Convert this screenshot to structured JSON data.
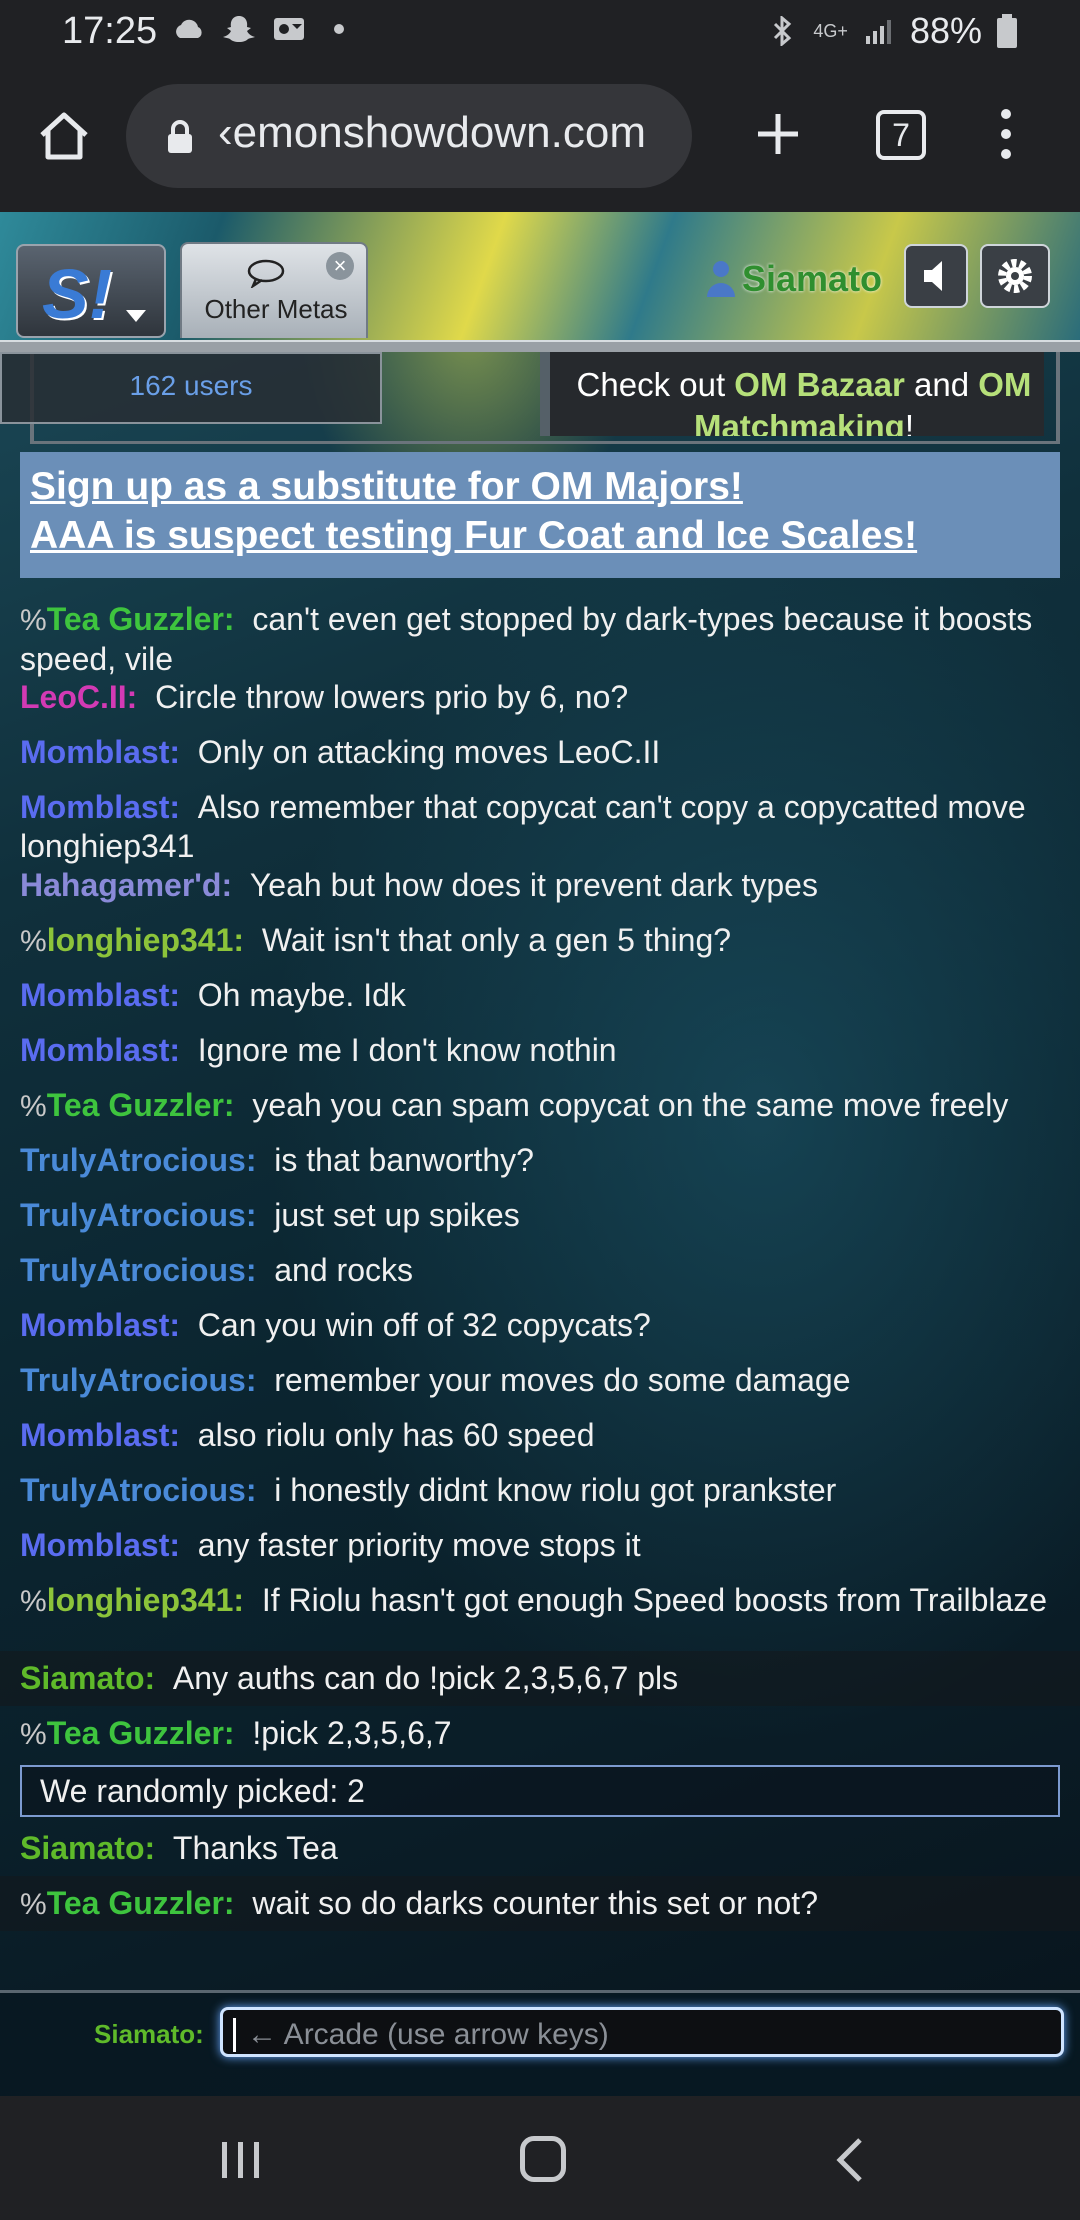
{
  "status_bar": {
    "time": "17:25",
    "network": "4G+",
    "battery": "88%",
    "icons": [
      "cloud-icon",
      "snapchat-icon",
      "outlook-icon",
      "dot-icon",
      "bluetooth-icon",
      "signal-icon",
      "battery-icon"
    ]
  },
  "browser": {
    "url": "‹emonshowdown.com",
    "tab_count": "7"
  },
  "header": {
    "logo_text": "S!",
    "room_tab_label": "Other Metas",
    "room_tab_close": "×",
    "username": "Siamato"
  },
  "room_intro": {
    "users_count": "162 users",
    "om_text_before": "Check out ",
    "om_bazaar": "OM Bazaar",
    "om_and": " and ",
    "om_matchmaking": "OM Matchmaking",
    "om_end": "!"
  },
  "announcement": {
    "line1": "Sign up as a substitute for OM Majors!",
    "line2": "AAA is suspect testing Fur Coat and Ice Scales!"
  },
  "messages": [
    {
      "rank": "%",
      "user": "Tea Guzzler",
      "color": "#3ec43e",
      "text": "can't even get stopped by dark-types because it boosts speed, vile"
    },
    {
      "rank": "",
      "user": "LeoC.II",
      "color": "#d33ab4",
      "text": "Circle throw lowers prio by 6, no?"
    },
    {
      "rank": "",
      "user": "Momblast",
      "color": "#5a6cf0",
      "text": "Only on attacking moves LeoC.II"
    },
    {
      "rank": "",
      "user": "Momblast",
      "color": "#5a6cf0",
      "text": "Also remember that copycat can't copy a copycatted move longhiep341"
    },
    {
      "rank": "",
      "user": "Hahagamer'd",
      "color": "#8a8ad8",
      "text": "Yeah but how does it prevent dark types"
    },
    {
      "rank": "%",
      "user": "longhiep341",
      "color": "#8cc43a",
      "text": "Wait isn't that only a gen 5 thing?"
    },
    {
      "rank": "",
      "user": "Momblast",
      "color": "#5a6cf0",
      "text": "Oh maybe. Idk"
    },
    {
      "rank": "",
      "user": "Momblast",
      "color": "#5a6cf0",
      "text": "Ignore me I don't know nothin"
    },
    {
      "rank": "%",
      "user": "Tea Guzzler",
      "color": "#3ec43e",
      "text": "yeah you can spam copycat on the same move freely"
    },
    {
      "rank": "",
      "user": "TrulyAtrocious",
      "color": "#4a8ad8",
      "text": "is that banworthy?"
    },
    {
      "rank": "",
      "user": "TrulyAtrocious",
      "color": "#4a8ad8",
      "text": "just set up spikes"
    },
    {
      "rank": "",
      "user": "TrulyAtrocious",
      "color": "#4a8ad8",
      "text": "and rocks"
    },
    {
      "rank": "",
      "user": "Momblast",
      "color": "#5a6cf0",
      "text": "Can you win off of 32 copycats?"
    },
    {
      "rank": "",
      "user": "TrulyAtrocious",
      "color": "#4a8ad8",
      "text": "remember your moves do some damage"
    },
    {
      "rank": "",
      "user": "Momblast",
      "color": "#5a6cf0",
      "text": "also riolu only has 60 speed"
    },
    {
      "rank": "",
      "user": "TrulyAtrocious",
      "color": "#4a8ad8",
      "text": "i honestly didnt know riolu got prankster"
    },
    {
      "rank": "",
      "user": "Momblast",
      "color": "#5a6cf0",
      "text": "any faster priority move stops it"
    },
    {
      "rank": "%",
      "user": "longhiep341",
      "color": "#8cc43a",
      "text": "If Riolu hasn't got enough Speed boosts from Trailblaze"
    },
    {
      "rank": "",
      "user": "Siamato",
      "color": "#5fba2a",
      "text": "Any auths can do !pick 2,3,5,6,7 pls"
    },
    {
      "rank": "%",
      "user": "Tea Guzzler",
      "color": "#3ec43e",
      "text": "!pick 2,3,5,6,7"
    }
  ],
  "random_pick": "We randomly picked:  2",
  "messages_after": [
    {
      "rank": "",
      "user": "Siamato",
      "color": "#5fba2a",
      "text": "Thanks Tea"
    },
    {
      "rank": "%",
      "user": "Tea Guzzler",
      "color": "#3ec43e",
      "text": "wait so do darks counter this set or not?"
    }
  ],
  "chat_input": {
    "label": "Siamato:",
    "placeholder": "← Arcade (use arrow keys)"
  }
}
